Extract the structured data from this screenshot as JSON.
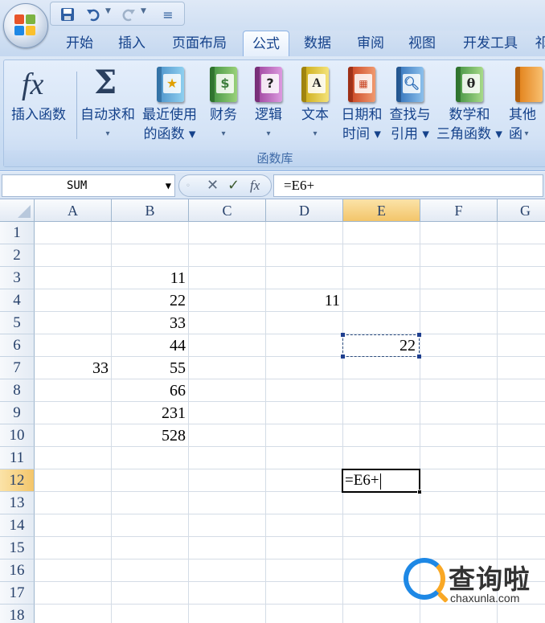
{
  "quick_access": {
    "save_icon": "save-icon",
    "undo_icon": "undo-icon",
    "redo_icon": "redo-icon",
    "customize_glyph": "≡"
  },
  "tabs": [
    {
      "label": "开始",
      "active": false
    },
    {
      "label": "插入",
      "active": false
    },
    {
      "label": "页面布局",
      "active": false
    },
    {
      "label": "公式",
      "active": true
    },
    {
      "label": "数据",
      "active": false
    },
    {
      "label": "审阅",
      "active": false
    },
    {
      "label": "视图",
      "active": false
    },
    {
      "label": "开发工具",
      "active": false
    },
    {
      "label": "祁",
      "active": false
    }
  ],
  "ribbon": {
    "group_label": "函数库",
    "insert_function": {
      "line1": "插入函数",
      "line2": ""
    },
    "autosum": {
      "line1": "自动求和",
      "line2": "▾"
    },
    "recent": {
      "line1": "最近使用",
      "line2": "的函数 ▾"
    },
    "financial": {
      "line1": "财务",
      "line2": "▾"
    },
    "logical": {
      "line1": "逻辑",
      "line2": "▾"
    },
    "text": {
      "line1": "文本",
      "line2": "▾"
    },
    "datetime": {
      "line1": "日期和",
      "line2": "时间 ▾"
    },
    "lookup": {
      "line1": "查找与",
      "line2": "引用 ▾"
    },
    "math": {
      "line1": "数学和",
      "line2": "三角函数 ▾"
    },
    "more": {
      "line1": "其他函",
      "line2": "▾"
    }
  },
  "formula_bar": {
    "name_box": "SUM",
    "formula": "=E6+",
    "fx_label": "fx"
  },
  "columns": [
    "A",
    "B",
    "C",
    "D",
    "E",
    "F",
    "G"
  ],
  "selected_column": "E",
  "rows": [
    "1",
    "2",
    "3",
    "4",
    "5",
    "6",
    "7",
    "8",
    "9",
    "10",
    "11",
    "12",
    "13",
    "14",
    "15",
    "16",
    "17",
    "18"
  ],
  "selected_row": "12",
  "cells": {
    "B3": "11",
    "B4": "22",
    "B5": "33",
    "B6": "44",
    "B7": "55",
    "B8": "66",
    "B9": "231",
    "B10": "528",
    "D4": "11",
    "E6": "22",
    "A7": "33"
  },
  "active_cell_text": "=E6+",
  "watermark": {
    "title": "查询啦",
    "url": "chaxunla.com"
  }
}
